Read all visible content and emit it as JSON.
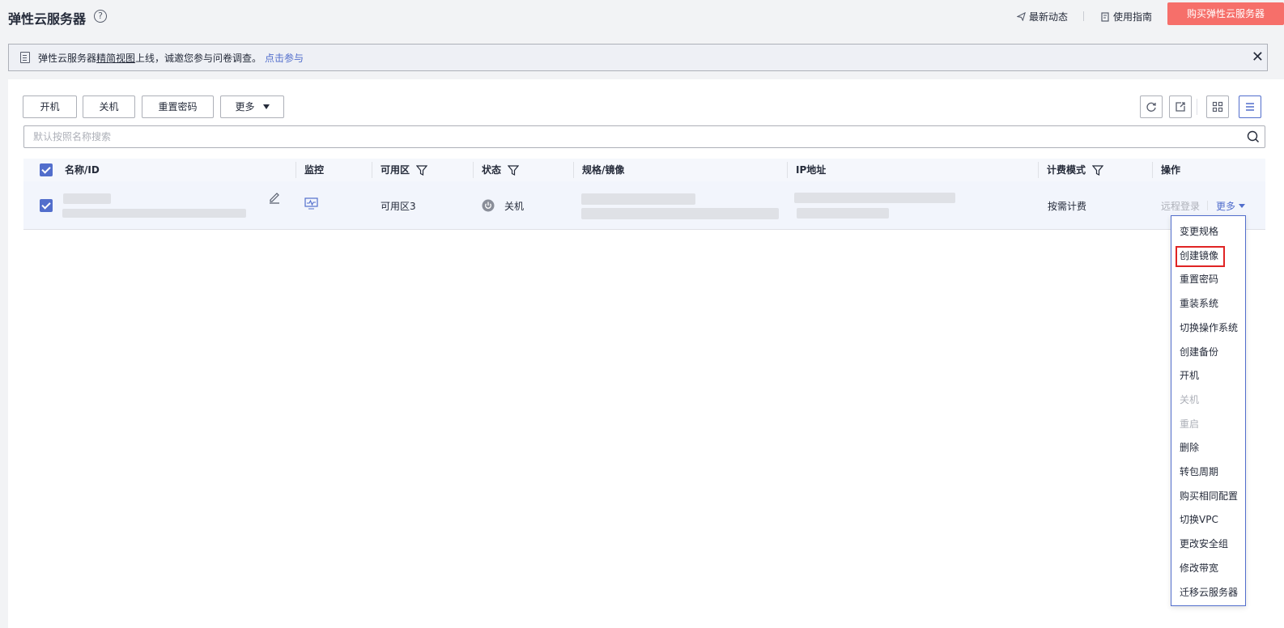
{
  "header": {
    "title": "弹性云服务器",
    "help_icon": "?",
    "news_label": "最新动态",
    "guide_label": "使用指南",
    "buy_label": "购买弹性云服务器"
  },
  "notice": {
    "text_before": "弹性云服务器",
    "link_underlined": "精简视图",
    "text_after": "上线，诚邀您参与问卷调查。",
    "cta": "点击参与",
    "close": "✕"
  },
  "toolbar": {
    "start_label": "开机",
    "stop_label": "关机",
    "reset_password_label": "重置密码",
    "more_label": "更多"
  },
  "search": {
    "placeholder": "默认按照名称搜索"
  },
  "table": {
    "columns": {
      "name": "名称/ID",
      "monitor": "监控",
      "zone": "可用区",
      "status": "状态",
      "spec": "规格/镜像",
      "ip": "IP地址",
      "billing": "计费模式",
      "ops": "操作"
    },
    "row": {
      "zone": "可用区3",
      "status": "关机",
      "billing": "按需计费",
      "remote_login": "远程登录",
      "more": "更多"
    }
  },
  "dropdown": {
    "items": [
      {
        "label": "变更规格",
        "disabled": false
      },
      {
        "label": "创建镜像",
        "disabled": false
      },
      {
        "label": "重置密码",
        "disabled": false
      },
      {
        "label": "重装系统",
        "disabled": false
      },
      {
        "label": "切换操作系统",
        "disabled": false
      },
      {
        "label": "创建备份",
        "disabled": false
      },
      {
        "label": "开机",
        "disabled": false
      },
      {
        "label": "关机",
        "disabled": true
      },
      {
        "label": "重启",
        "disabled": true
      },
      {
        "label": "删除",
        "disabled": false
      },
      {
        "label": "转包周期",
        "disabled": false
      },
      {
        "label": "购买相同配置",
        "disabled": false
      },
      {
        "label": "切换VPC",
        "disabled": false
      },
      {
        "label": "更改安全组",
        "disabled": false
      },
      {
        "label": "修改带宽",
        "disabled": false
      },
      {
        "label": "迁移云服务器",
        "disabled": false
      }
    ]
  },
  "colors": {
    "accent": "#526ecc",
    "buy_button": "#f66f6a",
    "highlight_box": "#e02424"
  }
}
